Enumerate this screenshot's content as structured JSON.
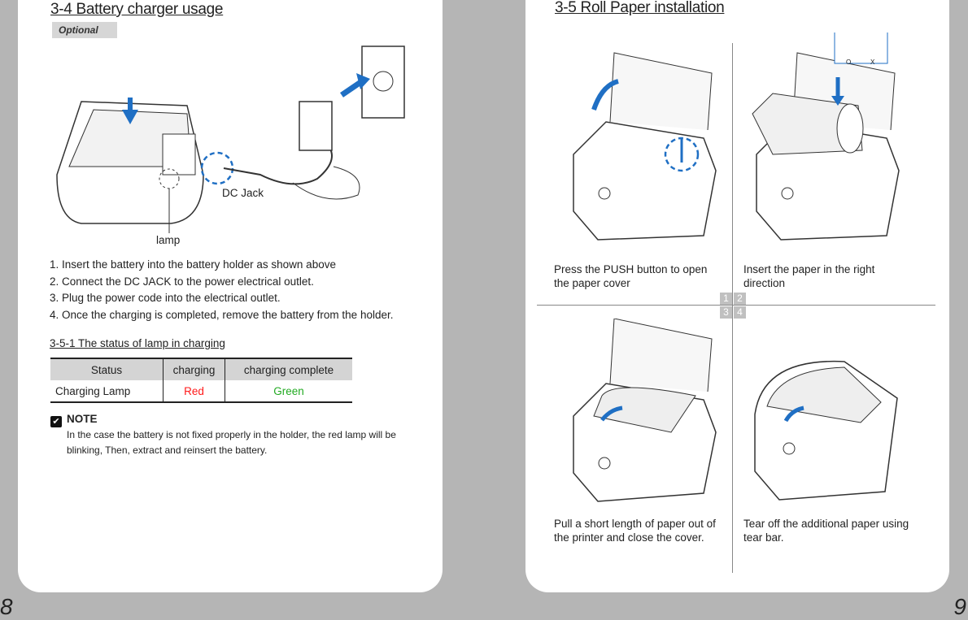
{
  "left_page": {
    "title": "3-4 Battery charger usage",
    "badge": "Optional",
    "labels": {
      "dc_jack": "DC Jack",
      "lamp": "lamp"
    },
    "steps": [
      "1. Insert the battery into the battery holder as shown above",
      "2. Connect the DC JACK to the power electrical outlet.",
      "3. Plug the power code into the electrical outlet.",
      "4. Once the charging is completed, remove the battery from the holder."
    ],
    "subtitle": "3-5-1 The status of lamp in charging",
    "table": {
      "headers": [
        "Status",
        "charging",
        "charging complete"
      ],
      "row": [
        "Charging Lamp",
        "Red",
        "Green"
      ]
    },
    "colors": {
      "red": "#ff1a1a",
      "green": "#22aa22",
      "accent": "#1f6fc4"
    },
    "note": {
      "title": "NOTE",
      "text": "In the case the battery is not fixed properly in the holder, the red lamp will be blinking, Then, extract and reinsert the battery."
    },
    "page_number": "8"
  },
  "right_page": {
    "title": "3-5 Roll Paper installation",
    "quadrants": [
      "1",
      "2",
      "3",
      "4"
    ],
    "orientation": {
      "ok": "O",
      "bad": "X"
    },
    "captions": [
      "Press the PUSH button to open the paper cover",
      "Insert the paper in the right direction",
      "Pull a short length of paper out of the printer and close the cover.",
      "Tear off the additional paper using tear bar."
    ],
    "page_number": "9"
  }
}
